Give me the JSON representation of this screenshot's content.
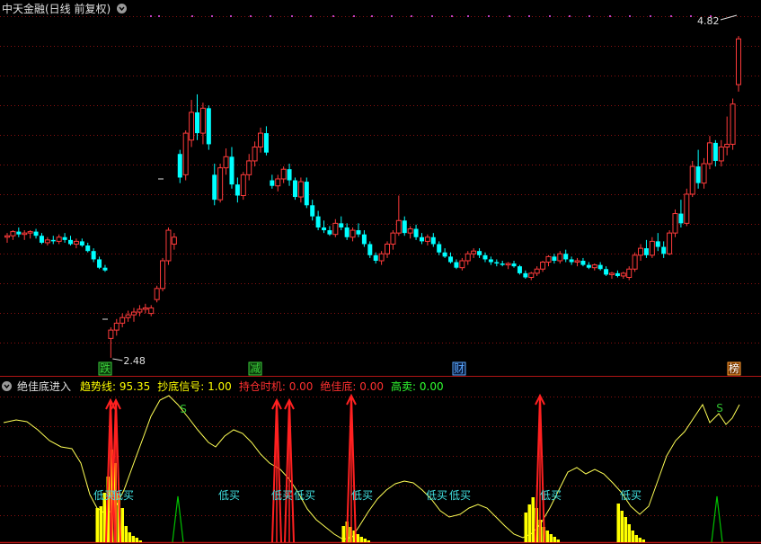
{
  "main_title": "中天金融(日线 前复权)",
  "price_max_label": "4.82",
  "price_min_label": "2.48",
  "badges": [
    {
      "text": "跌",
      "color": "#3ccf3c",
      "bg": "#0a3a0a",
      "border": "#3ccf3c"
    },
    {
      "text": "减",
      "color": "#3ccf3c",
      "bg": "#0a3a0a",
      "border": "#3ccf3c"
    },
    {
      "text": "财",
      "color": "#5aa9ff",
      "bg": "#0a1a3a",
      "border": "#5aa9ff"
    },
    {
      "text": "榜",
      "color": "#ffffff",
      "bg": "#7a3a00",
      "border": "#ff9a30"
    }
  ],
  "indicator": {
    "name": "绝佳底进入",
    "items": [
      {
        "label": "趋势线:",
        "value": "95.35",
        "color": "#ffff00"
      },
      {
        "label": "抄底信号:",
        "value": "1.00",
        "color": "#ffff00"
      },
      {
        "label": "持仓时机:",
        "value": "0.00",
        "color": "#ff3030"
      },
      {
        "label": "绝佳底:",
        "value": "0.00",
        "color": "#ff3030"
      },
      {
        "label": "高卖:",
        "value": "0.00",
        "color": "#30ff30"
      }
    ],
    "low_buy_label": "低买",
    "sell_label": "S"
  },
  "colors": {
    "up": "#ff3b3b",
    "down": "#00ffff",
    "grid": "#8a1010",
    "trend": "#ffff55",
    "signal": "#ff2020",
    "volume": "#ffff00",
    "high_sell": "#00c000"
  },
  "chart_data": {
    "type": "candlestick",
    "title": "中天金融(日线 前复权)",
    "ylim": [
      2.35,
      4.95
    ],
    "candles": [
      [
        3.35,
        3.38,
        3.31,
        3.36
      ],
      [
        3.36,
        3.4,
        3.33,
        3.39
      ],
      [
        3.39,
        3.42,
        3.35,
        3.37
      ],
      [
        3.37,
        3.4,
        3.33,
        3.38
      ],
      [
        3.38,
        3.4,
        3.34,
        3.39
      ],
      [
        3.39,
        3.41,
        3.34,
        3.36
      ],
      [
        3.36,
        3.38,
        3.3,
        3.31
      ],
      [
        3.31,
        3.35,
        3.29,
        3.33
      ],
      [
        3.33,
        3.36,
        3.3,
        3.32
      ],
      [
        3.32,
        3.37,
        3.3,
        3.35
      ],
      [
        3.35,
        3.38,
        3.31,
        3.33
      ],
      [
        3.33,
        3.36,
        3.29,
        3.3
      ],
      [
        3.3,
        3.34,
        3.27,
        3.32
      ],
      [
        3.32,
        3.34,
        3.28,
        3.29
      ],
      [
        3.29,
        3.31,
        3.24,
        3.25
      ],
      [
        3.25,
        3.27,
        3.17,
        3.19
      ],
      [
        3.19,
        3.21,
        3.12,
        3.13
      ],
      [
        3.13,
        3.15,
        3.1,
        3.11
      ],
      [
        2.62,
        2.7,
        2.48,
        2.68
      ],
      [
        2.68,
        2.76,
        2.64,
        2.73
      ],
      [
        2.73,
        2.8,
        2.7,
        2.77
      ],
      [
        2.77,
        2.82,
        2.74,
        2.79
      ],
      [
        2.79,
        2.84,
        2.74,
        2.81
      ],
      [
        2.81,
        2.86,
        2.78,
        2.83
      ],
      [
        2.83,
        2.87,
        2.8,
        2.84
      ],
      [
        2.8,
        2.86,
        2.78,
        2.84
      ],
      [
        2.9,
        3.0,
        2.88,
        2.98
      ],
      [
        2.98,
        3.2,
        2.96,
        3.18
      ],
      [
        3.18,
        3.42,
        3.15,
        3.4
      ],
      [
        3.3,
        3.38,
        3.26,
        3.35
      ],
      [
        3.95,
        3.98,
        3.74,
        3.78
      ],
      [
        3.8,
        4.12,
        3.76,
        4.1
      ],
      [
        4.05,
        4.34,
        4.0,
        4.25
      ],
      [
        4.25,
        4.38,
        4.05,
        4.1
      ],
      [
        4.1,
        4.32,
        4.02,
        4.28
      ],
      [
        4.28,
        4.3,
        3.98,
        4.02
      ],
      [
        3.8,
        3.88,
        3.58,
        3.62
      ],
      [
        3.62,
        3.88,
        3.6,
        3.85
      ],
      [
        3.85,
        3.99,
        3.8,
        3.93
      ],
      [
        3.93,
        4.0,
        3.7,
        3.73
      ],
      [
        3.73,
        3.78,
        3.6,
        3.65
      ],
      [
        3.65,
        3.82,
        3.62,
        3.8
      ],
      [
        3.8,
        3.95,
        3.76,
        3.9
      ],
      [
        3.9,
        4.04,
        3.86,
        4.0
      ],
      [
        4.0,
        4.14,
        3.96,
        4.1
      ],
      [
        4.1,
        4.15,
        3.94,
        3.96
      ],
      [
        3.76,
        3.8,
        3.7,
        3.72
      ],
      [
        3.72,
        3.8,
        3.68,
        3.77
      ],
      [
        3.77,
        3.86,
        3.74,
        3.84
      ],
      [
        3.84,
        3.88,
        3.72,
        3.76
      ],
      [
        3.76,
        3.78,
        3.62,
        3.64
      ],
      [
        3.64,
        3.78,
        3.6,
        3.75
      ],
      [
        3.75,
        3.78,
        3.56,
        3.58
      ],
      [
        3.58,
        3.62,
        3.47,
        3.5
      ],
      [
        3.5,
        3.54,
        3.4,
        3.42
      ],
      [
        3.42,
        3.47,
        3.38,
        3.4
      ],
      [
        3.4,
        3.43,
        3.36,
        3.37
      ],
      [
        3.37,
        3.48,
        3.35,
        3.45
      ],
      [
        3.45,
        3.5,
        3.4,
        3.42
      ],
      [
        3.42,
        3.45,
        3.33,
        3.35
      ],
      [
        3.35,
        3.42,
        3.32,
        3.4
      ],
      [
        3.4,
        3.45,
        3.35,
        3.37
      ],
      [
        3.37,
        3.4,
        3.28,
        3.3
      ],
      [
        3.3,
        3.32,
        3.2,
        3.22
      ],
      [
        3.22,
        3.24,
        3.16,
        3.18
      ],
      [
        3.18,
        3.25,
        3.15,
        3.23
      ],
      [
        3.23,
        3.32,
        3.2,
        3.3
      ],
      [
        3.3,
        3.4,
        3.26,
        3.38
      ],
      [
        3.38,
        3.65,
        3.36,
        3.47
      ],
      [
        3.47,
        3.5,
        3.36,
        3.38
      ],
      [
        3.38,
        3.43,
        3.34,
        3.41
      ],
      [
        3.41,
        3.44,
        3.33,
        3.35
      ],
      [
        3.35,
        3.38,
        3.3,
        3.32
      ],
      [
        3.32,
        3.37,
        3.29,
        3.35
      ],
      [
        3.35,
        3.38,
        3.28,
        3.3
      ],
      [
        3.3,
        3.32,
        3.22,
        3.24
      ],
      [
        3.24,
        3.27,
        3.2,
        3.21
      ],
      [
        3.21,
        3.24,
        3.16,
        3.17
      ],
      [
        3.17,
        3.19,
        3.12,
        3.13
      ],
      [
        3.13,
        3.2,
        3.11,
        3.18
      ],
      [
        3.18,
        3.25,
        3.15,
        3.23
      ],
      [
        3.23,
        3.27,
        3.2,
        3.25
      ],
      [
        3.25,
        3.27,
        3.2,
        3.22
      ],
      [
        3.22,
        3.24,
        3.17,
        3.19
      ],
      [
        3.19,
        3.21,
        3.15,
        3.17
      ],
      [
        3.17,
        3.19,
        3.14,
        3.16
      ],
      [
        3.16,
        3.18,
        3.14,
        3.15
      ],
      [
        3.15,
        3.17,
        3.12,
        3.16
      ],
      [
        3.16,
        3.18,
        3.13,
        3.14
      ],
      [
        3.14,
        3.15,
        3.08,
        3.09
      ],
      [
        3.09,
        3.11,
        3.05,
        3.06
      ],
      [
        3.06,
        3.1,
        3.04,
        3.09
      ],
      [
        3.09,
        3.14,
        3.07,
        3.12
      ],
      [
        3.12,
        3.18,
        3.1,
        3.17
      ],
      [
        3.17,
        3.22,
        3.14,
        3.21
      ],
      [
        3.21,
        3.23,
        3.16,
        3.18
      ],
      [
        3.18,
        3.25,
        3.16,
        3.23
      ],
      [
        3.23,
        3.26,
        3.17,
        3.19
      ],
      [
        3.19,
        3.21,
        3.15,
        3.17
      ],
      [
        3.17,
        3.2,
        3.14,
        3.18
      ],
      [
        3.18,
        3.2,
        3.14,
        3.15
      ],
      [
        3.15,
        3.17,
        3.12,
        3.13
      ],
      [
        3.13,
        3.16,
        3.11,
        3.15
      ],
      [
        3.15,
        3.17,
        3.11,
        3.12
      ],
      [
        3.12,
        3.14,
        3.07,
        3.08
      ],
      [
        3.08,
        3.1,
        3.05,
        3.09
      ],
      [
        3.09,
        3.11,
        3.06,
        3.07
      ],
      [
        3.07,
        3.1,
        3.05,
        3.09
      ],
      [
        3.06,
        3.14,
        3.04,
        3.12
      ],
      [
        3.12,
        3.24,
        3.1,
        3.22
      ],
      [
        3.22,
        3.3,
        3.18,
        3.27
      ],
      [
        3.27,
        3.33,
        3.2,
        3.22
      ],
      [
        3.22,
        3.35,
        3.2,
        3.32
      ],
      [
        3.32,
        3.38,
        3.25,
        3.28
      ],
      [
        3.28,
        3.32,
        3.2,
        3.23
      ],
      [
        3.23,
        3.4,
        3.22,
        3.38
      ],
      [
        3.38,
        3.55,
        3.35,
        3.52
      ],
      [
        3.52,
        3.62,
        3.42,
        3.45
      ],
      [
        3.45,
        3.7,
        3.43,
        3.66
      ],
      [
        3.66,
        3.9,
        3.64,
        3.86
      ],
      [
        3.86,
        3.98,
        3.7,
        3.74
      ],
      [
        3.74,
        3.92,
        3.7,
        3.88
      ],
      [
        3.88,
        4.08,
        3.84,
        4.03
      ],
      [
        4.03,
        4.05,
        3.86,
        3.9
      ],
      [
        3.9,
        4.05,
        3.86,
        4.0
      ],
      [
        4.0,
        4.22,
        3.94,
        4.02
      ],
      [
        4.02,
        4.35,
        3.98,
        4.31
      ],
      [
        4.45,
        4.8,
        4.4,
        4.78
      ]
    ]
  }
}
